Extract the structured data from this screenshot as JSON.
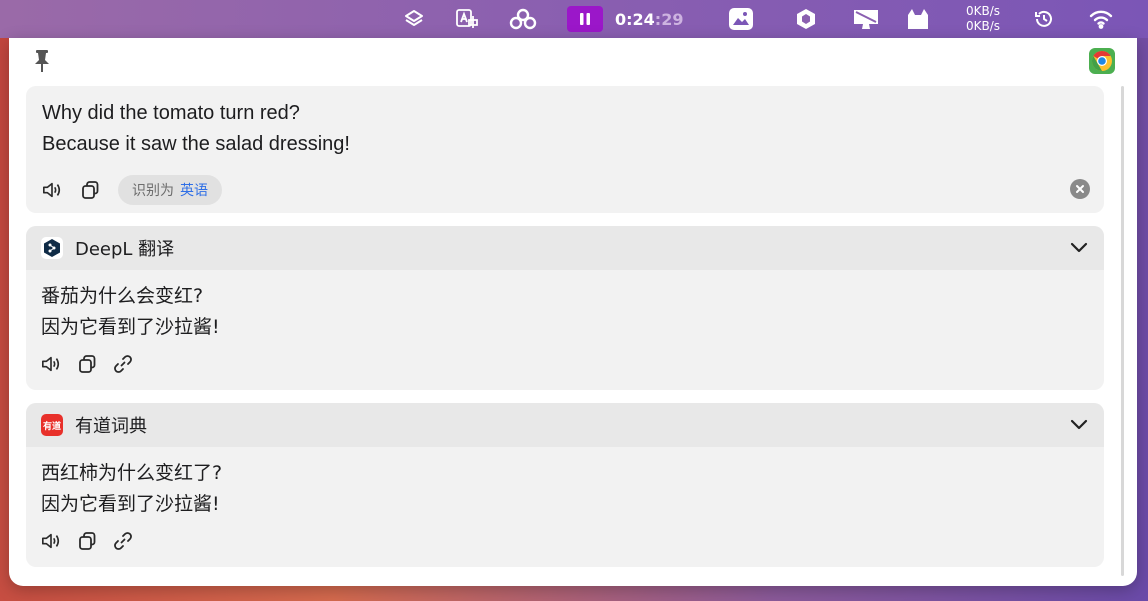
{
  "menubar": {
    "timer_main": "0:24",
    "timer_dim": ":29",
    "net_up": "0KB/s",
    "net_down": "0KB/s"
  },
  "source": {
    "line1": "Why did the tomato turn red?",
    "line2": "Because it saw the salad dressing!",
    "detected_prefix": "识别为",
    "detected_lang": "英语"
  },
  "services": [
    {
      "name": "DeepL 翻译",
      "line1": "番茄为什么会变红?",
      "line2": "因为它看到了沙拉酱!"
    },
    {
      "name": "有道词典",
      "logo_text": "有道",
      "line1": "西红柿为什么变红了?",
      "line2": "因为它看到了沙拉酱!"
    }
  ],
  "colors": {
    "accent_blue": "#2f6fe6",
    "pause_purple": "#9b17c9",
    "deepl_navy": "#0f2b46",
    "youdao_red": "#e8302a"
  }
}
